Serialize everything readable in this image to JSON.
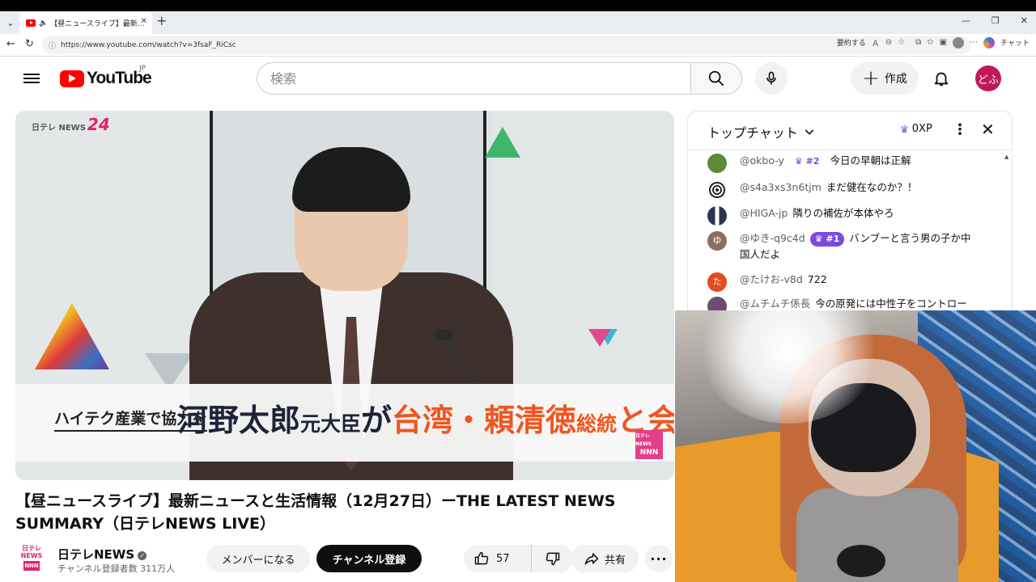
{
  "browser": {
    "tab_title": "【昼ニュースライブ】最新ニュースと生",
    "url": "https://www.youtube.com/watch?v=3fsaF_RiCsc",
    "summarize_label": "要約する",
    "copilot_label": "チャット"
  },
  "header": {
    "logo_text": "YouTube",
    "region": "JP",
    "search_placeholder": "検索",
    "create_label": "作成",
    "avatar_text": "どふ"
  },
  "video_overlay": {
    "channel_logo_small": "日テレ NEWS",
    "channel_logo_num": "24",
    "caption_small": "ハイテク産業で協力を",
    "caption_big_1": "河野太郎",
    "caption_big_2": "元大臣",
    "caption_big_3": "が",
    "caption_big_4": "台湾・頼清徳",
    "caption_big_5": "総統",
    "caption_big_6": "と会談",
    "nnn_top": "日テレNEWS",
    "nnn": "NNN"
  },
  "video": {
    "title": "【昼ニュースライブ】最新ニュースと生活情報（12月27日）ーTHE LATEST NEWS SUMMARY（日テレNEWS LIVE）"
  },
  "owner": {
    "avatar_top": "日テレ",
    "avatar_mid": "NEWS",
    "avatar_box": "NNN",
    "channel_name": "日テレNEWS",
    "subscribers": "チャンネル登録者数 311万人",
    "member_label": "メンバーになる",
    "subscribe_label": "チャンネル登録",
    "like_count": "57",
    "share_label": "共有"
  },
  "chat": {
    "title": "トップチャット",
    "xp": "0XP",
    "messages": [
      {
        "author": "@okbo-y",
        "rank": "#2",
        "text": "今日の早朝は正解",
        "avatar_color": "#5c8a3a"
      },
      {
        "author": "@s4a3xs3n6tjm",
        "rank": "",
        "text": "まだ健在なのか？！",
        "avatar_color": "#222222"
      },
      {
        "author": "@HIGA-jp",
        "rank": "",
        "text": "隣りの補佐が本体やろ",
        "avatar_color": "#2b3552"
      },
      {
        "author": "@ゆき-q9c4d",
        "rank": "#1",
        "text": "バンブーと言う男の子か中国人だよ",
        "avatar_color": "#8d6e63",
        "avatar_letter": "ゆ"
      },
      {
        "author": "@たけお-v8d",
        "rank": "",
        "text": "722",
        "avatar_color": "#e64a19",
        "avatar_letter": "た"
      },
      {
        "author": "@ムチムチ係長",
        "rank": "",
        "text": "今の原発には中性子をコントロー",
        "avatar_color": "#6d4c71"
      }
    ]
  }
}
